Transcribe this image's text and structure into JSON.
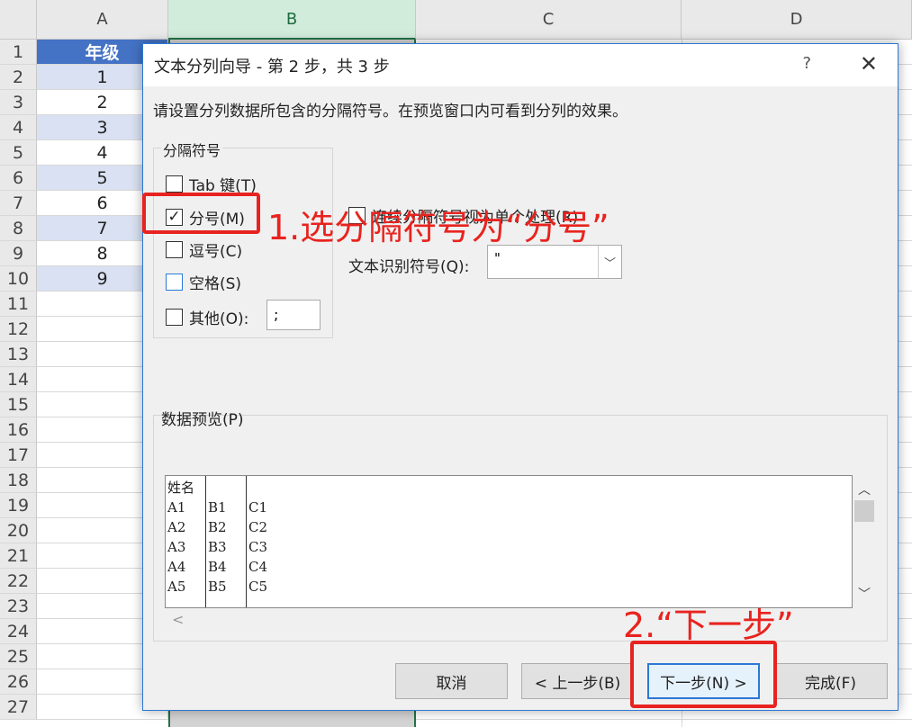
{
  "spreadsheet": {
    "columns": [
      "A",
      "B",
      "C",
      "D"
    ],
    "rows": [
      "1",
      "2",
      "3",
      "4",
      "5",
      "6",
      "7",
      "8",
      "9",
      "10",
      "11",
      "12",
      "13",
      "14",
      "15",
      "16",
      "17",
      "18",
      "19",
      "20",
      "21",
      "22",
      "23",
      "24",
      "25",
      "26",
      "27"
    ],
    "column_a": [
      "年级",
      "1",
      "2",
      "3",
      "4",
      "5",
      "6",
      "7",
      "8",
      "9"
    ]
  },
  "dialog": {
    "title": "文本分列向导 - 第 2 步，共 3 步",
    "help": "?",
    "close": "✕",
    "instruction": "请设置分列数据所包含的分隔符号。在预览窗口内可看到分列的效果。",
    "delimiters_group": "分隔符号",
    "delimiters": {
      "tab": {
        "label": "Tab 键(T)",
        "checked": false
      },
      "semicolon": {
        "label": "分号(M)",
        "checked": true
      },
      "comma": {
        "label": "逗号(C)",
        "checked": false
      },
      "space": {
        "label": "空格(S)",
        "checked": false
      },
      "other": {
        "label": "其他(O):",
        "checked": false,
        "value": ";"
      }
    },
    "consecutive": {
      "label": "连续分隔符号视为单个处理(R)",
      "checked": false
    },
    "qualifier_label": "文本识别符号(Q):",
    "qualifier_value": "\"",
    "preview_label": "数据预览(P)",
    "preview_rows": [
      [
        "姓名",
        "",
        ""
      ],
      [
        "A1",
        "B1",
        "C1"
      ],
      [
        "A2",
        "B2",
        "C2"
      ],
      [
        "A3",
        "B3",
        "C3"
      ],
      [
        "A4",
        "B4",
        "C4"
      ],
      [
        "A5",
        "B5",
        "C5"
      ]
    ],
    "buttons": {
      "cancel": "取消",
      "back": "< 上一步(B)",
      "next": "下一步(N) >",
      "finish": "完成(F)"
    }
  },
  "annotations": {
    "step1": "1.选分隔符号为“分号”",
    "step2": "2.“下一步”"
  }
}
